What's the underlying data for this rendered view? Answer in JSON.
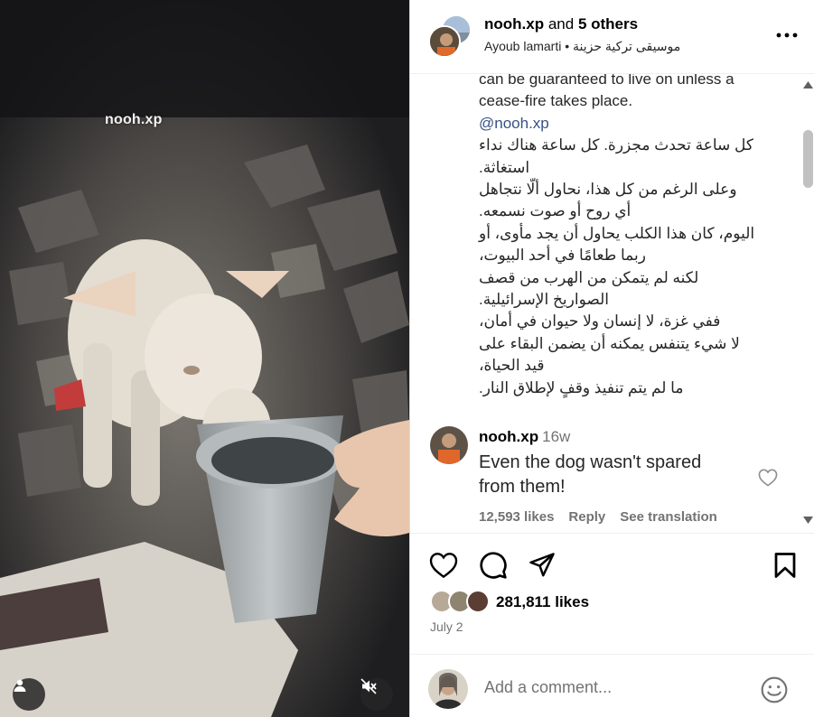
{
  "media": {
    "watermark": "nooh.xp",
    "tag_icon": "person-tag-icon",
    "mute_icon": "speaker-muted-icon"
  },
  "header": {
    "username": "nooh.xp",
    "and_text": "and",
    "others": "5 others",
    "subtitle_user": "Ayoub lamarti",
    "subtitle_sep": "•",
    "subtitle_audio": "موسيقى تركية حزينة",
    "more_icon": "more-options-icon"
  },
  "caption": {
    "en_lines": [
      "can be guaranteed to live on unless a",
      "cease-fire takes place."
    ],
    "mention": "@nooh.xp",
    "ar_lines": [
      "كل ساعة تحدث مجزرة. كل ساعة هناك نداء",
      "استغاثة.",
      "وعلى الرغم من كل هذا، نحاول ألّا نتجاهل",
      "أي روح أو صوت نسمعه.",
      "اليوم، كان هذا الكلب يحاول أن يجد مأوى، أو",
      "ربما طعامًا في أحد البيوت،",
      "لكنه لم يتمكن من الهرب من قصف",
      "الصواريخ الإسرائيلية.",
      "ففي غزة، لا إنسان ولا حيوان في أمان،",
      "لا شيء يتنفس يمكنه أن يضمن البقاء على",
      "قيد الحياة،",
      "ما لم يتم تنفيذ وقفٍ لإطلاق النار."
    ]
  },
  "comment": {
    "username": "nooh.xp",
    "time": "16w",
    "text": "Even the dog wasn't spared from them!",
    "likes": "12,593 likes",
    "reply": "Reply",
    "translate": "See translation"
  },
  "actions": {
    "like_icon": "heart-icon",
    "comment_icon": "comment-bubble-icon",
    "share_icon": "send-icon",
    "save_icon": "bookmark-icon",
    "likes": "281,811 likes",
    "date": "July 2"
  },
  "add_comment": {
    "placeholder": "Add a comment...",
    "emoji_icon": "emoji-icon"
  },
  "colors": {
    "link": "#385185",
    "muted": "#737373",
    "border": "#dbdbdb"
  }
}
